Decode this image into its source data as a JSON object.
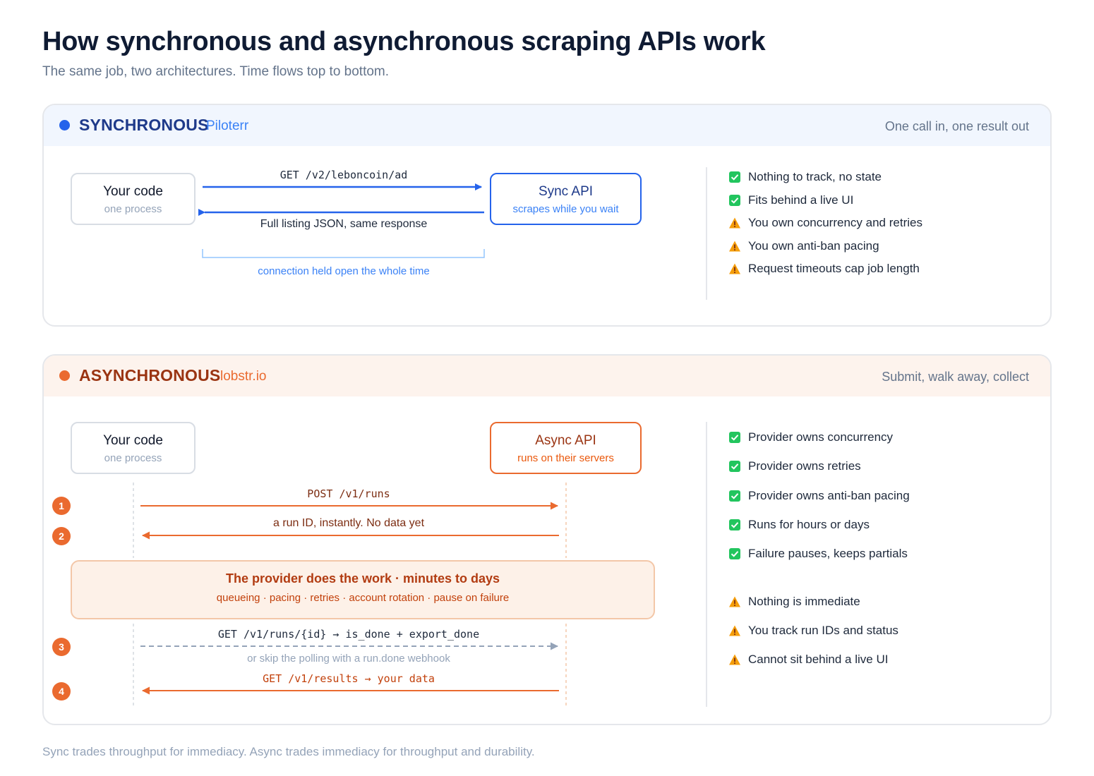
{
  "title": "How synchronous and asynchronous scraping APIs work",
  "subtitle": "The same job, two architectures. Time flows top to bottom.",
  "footer": "Sync trades throughput for immediacy. Async trades immediacy for throughput and durability.",
  "colors": {
    "sync_accent": "#2563eb",
    "async_accent": "#ea6a2f",
    "check": "#22c55e",
    "warning": "#f59e0b"
  },
  "sync": {
    "label": "SYNCHRONOUS",
    "provider": "Piloterr",
    "tagline": "One call in, one result out",
    "client": {
      "title": "Your code",
      "subtitle": "one process"
    },
    "api": {
      "title": "Sync API",
      "subtitle": "scrapes while you wait"
    },
    "request": "GET /v2/leboncoin/ad",
    "response": "Full listing JSON, same response",
    "connection_note": "connection held open the whole time",
    "points": [
      {
        "icon": "check-icon",
        "text": "Nothing to track, no state"
      },
      {
        "icon": "check-icon",
        "text": "Fits behind a live UI"
      },
      {
        "icon": "warning-icon",
        "text": "You own concurrency and retries"
      },
      {
        "icon": "warning-icon",
        "text": "You own anti-ban pacing"
      },
      {
        "icon": "warning-icon",
        "text": "Request timeouts cap job length"
      }
    ]
  },
  "async": {
    "label": "ASYNCHRONOUS",
    "provider": "lobstr.io",
    "tagline": "Submit, walk away, collect",
    "client": {
      "title": "Your code",
      "subtitle": "one process"
    },
    "api": {
      "title": "Async API",
      "subtitle": "runs on their servers"
    },
    "steps": [
      {
        "number": "1",
        "text": "POST /v1/runs"
      },
      {
        "number": "2",
        "text": "a run ID, instantly. No data yet"
      },
      {
        "number": "3",
        "text": "GET /v1/runs/{id} → is_done + export_done"
      },
      {
        "number": "4",
        "text": "GET /v1/results → your data"
      }
    ],
    "webhook_note": "or skip the polling with a run.done webhook",
    "work": {
      "title": "The provider does the work · minutes to days",
      "detail": "queueing · pacing · retries · account rotation · pause on failure"
    },
    "points": [
      {
        "icon": "check-icon",
        "text": "Provider owns concurrency"
      },
      {
        "icon": "check-icon",
        "text": "Provider owns retries"
      },
      {
        "icon": "check-icon",
        "text": "Provider owns anti-ban pacing"
      },
      {
        "icon": "check-icon",
        "text": "Runs for hours or days"
      },
      {
        "icon": "check-icon",
        "text": "Failure pauses, keeps partials"
      },
      {
        "icon": "warning-icon",
        "text": "Nothing is immediate"
      },
      {
        "icon": "warning-icon",
        "text": "You track run IDs and status"
      },
      {
        "icon": "warning-icon",
        "text": "Cannot sit behind a live UI"
      }
    ]
  }
}
